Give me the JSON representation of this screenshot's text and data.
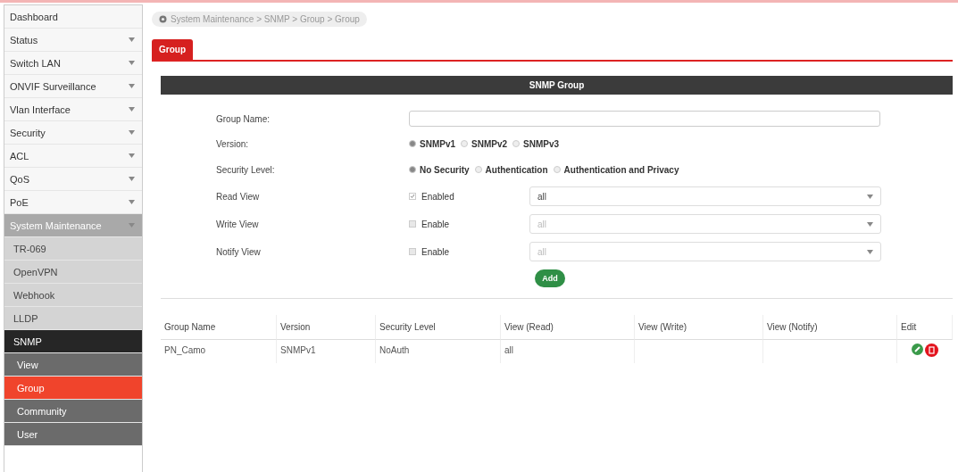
{
  "sidebar": {
    "items": [
      {
        "label": "Dashboard",
        "selected": false
      },
      {
        "label": "Status",
        "selected": false,
        "expanded": false
      },
      {
        "label": "Switch LAN",
        "selected": false,
        "expanded": false
      },
      {
        "label": "ONVIF Surveillance",
        "selected": false,
        "expanded": false
      },
      {
        "label": "Vlan Interface",
        "selected": false,
        "expanded": false
      },
      {
        "label": "Security",
        "selected": false,
        "expanded": false
      },
      {
        "label": "ACL",
        "selected": false,
        "expanded": false
      },
      {
        "label": "QoS",
        "selected": false,
        "expanded": false
      },
      {
        "label": "PoE",
        "selected": false,
        "expanded": false
      },
      {
        "label": "System Maintenance",
        "selected": false,
        "expanded": true,
        "children": [
          {
            "label": "TR-069",
            "selected": false
          },
          {
            "label": "OpenVPN",
            "selected": false
          },
          {
            "label": "Webhook",
            "selected": false
          },
          {
            "label": "LLDP",
            "selected": false
          },
          {
            "label": "SNMP",
            "selected": false,
            "children": [
              {
                "label": "View",
                "selected": false
              },
              {
                "label": "Group",
                "selected": true
              },
              {
                "label": "Community",
                "selected": false
              },
              {
                "label": "User",
                "selected": false
              }
            ]
          }
        ]
      }
    ]
  },
  "breadcrumb": "System Maintenance > SNMP > Group > Group",
  "tabs": [
    {
      "label": "Group",
      "selected": true
    }
  ],
  "panel": {
    "title": "SNMP Group",
    "fields": [
      {
        "kind": "text",
        "label": "Group Name:"
      },
      {
        "kind": "radio",
        "label": "Version:",
        "options": [
          {
            "label": "SNMPv1",
            "selected": true
          },
          {
            "label": "SNMPv2",
            "selected": false
          },
          {
            "label": "SNMPv3",
            "selected": false
          }
        ]
      },
      {
        "kind": "radio",
        "label": "Security Level:",
        "options": [
          {
            "label": "No Security",
            "selected": true
          },
          {
            "label": "Authentication",
            "selected": false
          },
          {
            "label": "Authentication and Privacy",
            "selected": false
          }
        ]
      },
      {
        "kind": "view",
        "label": "Read View",
        "check_label": "Enabled",
        "checked": true,
        "value": "all",
        "disabled": false
      },
      {
        "kind": "view",
        "label": "Write View",
        "check_label": "Enable",
        "checked": false,
        "value": "all",
        "disabled": true
      },
      {
        "kind": "view",
        "label": "Notify View",
        "check_label": "Enable",
        "checked": false,
        "value": "all",
        "disabled": true
      }
    ],
    "add_button": "Add"
  },
  "table": {
    "columns": [
      "Group Name",
      "Version",
      "Security Level",
      "View (Read)",
      "View (Write)",
      "View (Notify)",
      "Edit"
    ],
    "rows": [
      {
        "cells": [
          "PN_Camo",
          "SNMPv1",
          "NoAuth",
          "all",
          "",
          ""
        ]
      }
    ]
  }
}
